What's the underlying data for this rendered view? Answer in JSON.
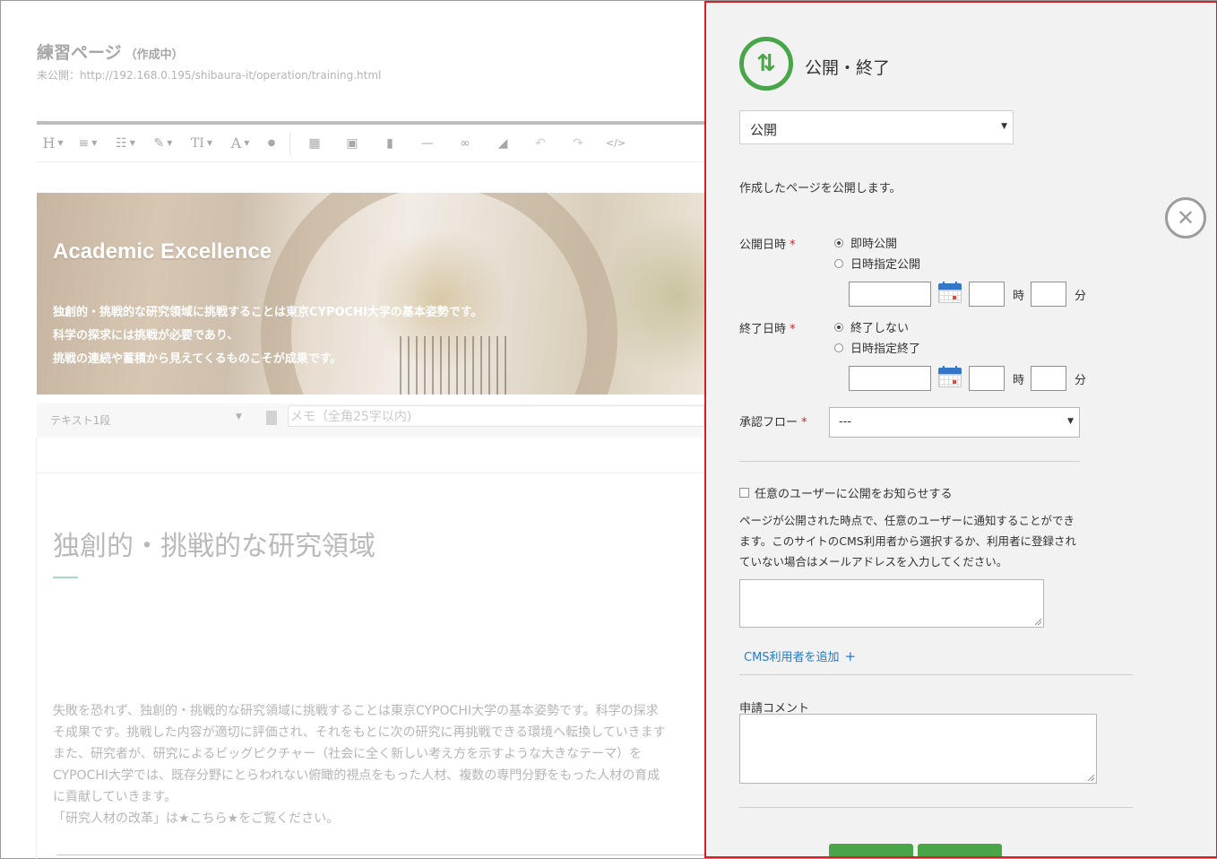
{
  "editor": {
    "page_title": "練習ページ",
    "page_status": "（作成中）",
    "page_url": "未公開：http://192.168.0.195/shibaura-it/operation/training.html",
    "toolbar": [
      {
        "icon": "heading-icon",
        "glyph": "H"
      },
      {
        "icon": "align-icon",
        "glyph": "≡"
      },
      {
        "icon": "list-icon",
        "glyph": "☷"
      },
      {
        "icon": "brush-icon",
        "glyph": "✎"
      },
      {
        "icon": "text-size-icon",
        "glyph": "TI"
      },
      {
        "icon": "font-color-icon",
        "glyph": "A"
      },
      {
        "icon": "drop-icon",
        "glyph": "●"
      },
      {
        "icon": "table-icon",
        "glyph": "▦"
      },
      {
        "icon": "image-icon",
        "glyph": "▣"
      },
      {
        "icon": "file-icon",
        "glyph": "▮"
      },
      {
        "icon": "horizontal-rule-icon",
        "glyph": "—"
      },
      {
        "icon": "link-icon",
        "glyph": "∞"
      },
      {
        "icon": "eraser-icon",
        "glyph": "◢"
      },
      {
        "icon": "undo-icon",
        "glyph": "↶"
      },
      {
        "icon": "redo-icon",
        "glyph": "↷"
      },
      {
        "icon": "code-icon",
        "glyph": "</>"
      }
    ],
    "hero": {
      "title": "Academic Excellence",
      "lines": [
        "独創的・挑戦的な研究領域に挑戦することは東京CYPOCHI大学の基本姿勢です。",
        "科学の探求には挑戦が必要であり、",
        "挑戦の連続や蓄積から見えてくるものこそが成果です。"
      ]
    },
    "block_type": "テキスト1段",
    "memo_placeholder": "メモ（全角25字以内)",
    "section_heading": "独創的・挑戦的な研究領域",
    "body_lines": [
      "失敗を恐れず、独創的・挑戦的な研究領域に挑戦することは東京CYPOCHI大学の基本姿勢です。科学の探求",
      "そ成果です。挑戦した内容が適切に評価され、それをもとに次の研究に再挑戦できる環境へ転換していきます",
      "また、研究者が、研究によるビッグピクチャー（社会に全く新しい考え方を示すような大きなテーマ）を",
      "CYPOCHI大学では、既存分野にとらわれない俯瞰的視点をもった人材、複数の専門分野をもった人材の育成",
      "に貢献していきます。",
      "「研究人材の改革」は★こちら★をご覧ください。"
    ]
  },
  "panel": {
    "icon": "publish-toggle-icon",
    "title": "公開・終了",
    "status_value": "公開",
    "description": "作成したページを公開します。",
    "publish": {
      "label": "公開日時",
      "option_now": "即時公開",
      "option_schedule": "日時指定公開",
      "hour_unit": "時",
      "minute_unit": "分",
      "selected": "now"
    },
    "end": {
      "label": "終了日時",
      "option_none": "終了しない",
      "option_schedule": "日時指定終了",
      "hour_unit": "時",
      "minute_unit": "分",
      "selected": "none"
    },
    "approval": {
      "label": "承認フロー",
      "value": "---"
    },
    "required_mark": "*",
    "notify_checkbox": "任意のユーザーに公開をお知らせする",
    "notify_description": [
      "ページが公開された時点で、任意のユーザーに通知することができ",
      "ます。このサイトのCMS利用者から選択するか、利用者に登録され",
      "ていない場合はメールアドレスを入力してください。"
    ],
    "add_cms_user": "CMS利用者を追加",
    "add_symbol": "+",
    "comment_label": "申請コメント"
  },
  "close_symbol": "✕",
  "colors": {
    "panel_border": "#d32027",
    "accent_green": "#48a548",
    "link_blue": "#2a79c7",
    "required_red": "#d32027"
  }
}
